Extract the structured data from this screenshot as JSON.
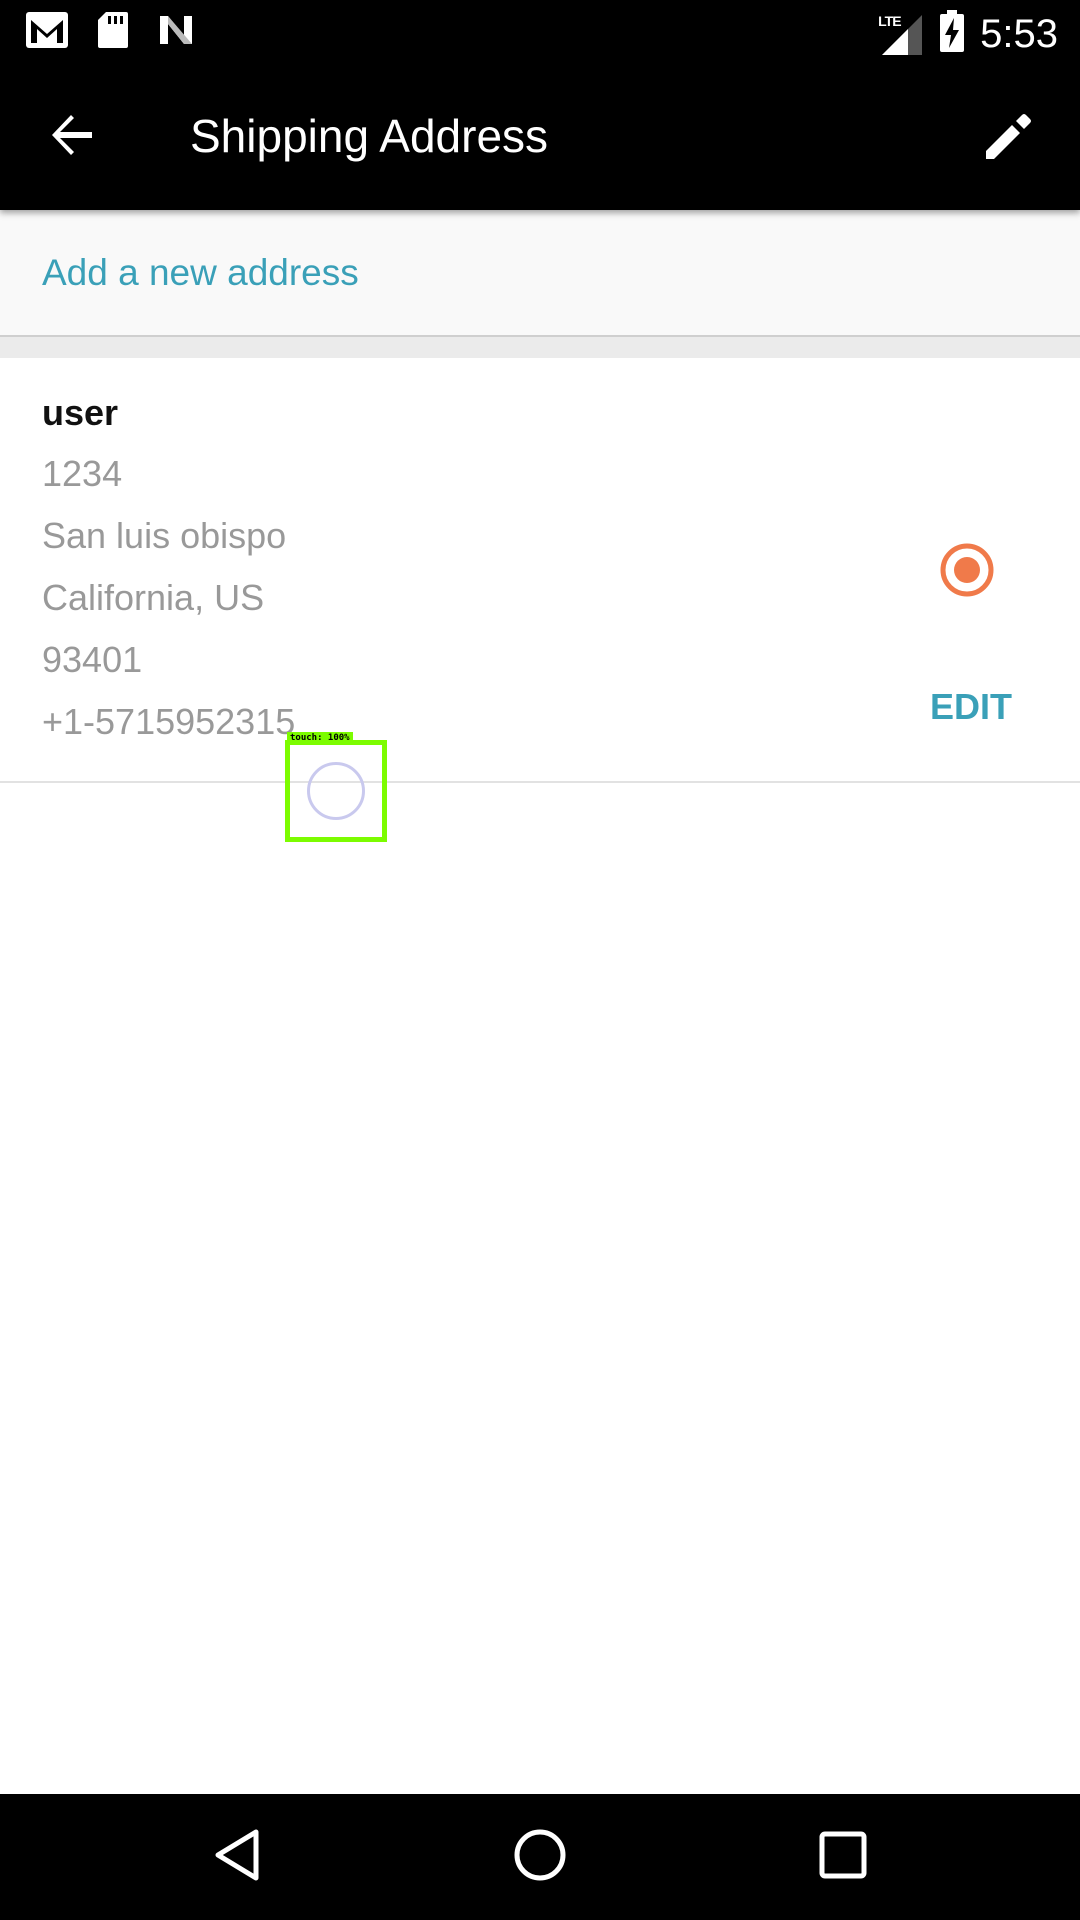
{
  "status_bar": {
    "time": "5:53",
    "network_label": "LTE",
    "icons": [
      "gmail-icon",
      "sd-card-icon",
      "n-icon",
      "lte-signal-icon",
      "battery-charging-icon"
    ]
  },
  "app_bar": {
    "title": "Shipping Address",
    "back_icon": "arrow-left-icon",
    "edit_icon": "pencil-icon"
  },
  "add_address": {
    "label": "Add a new address"
  },
  "address": {
    "name": "user",
    "line1": "1234",
    "city": "San luis obispo",
    "region": "California, US",
    "postal": "93401",
    "phone": "+1-5715952315",
    "selected": true,
    "edit_label": "EDIT"
  },
  "touch_overlay": {
    "label": "touch: 100%"
  },
  "nav_bar": {
    "icons": [
      "back-triangle-icon",
      "home-circle-icon",
      "recents-square-icon"
    ]
  },
  "colors": {
    "accent": "#3aa0b8",
    "radio": "#f07a4a",
    "secondary_text": "#999999",
    "touch_highlight": "#7cfc00"
  }
}
